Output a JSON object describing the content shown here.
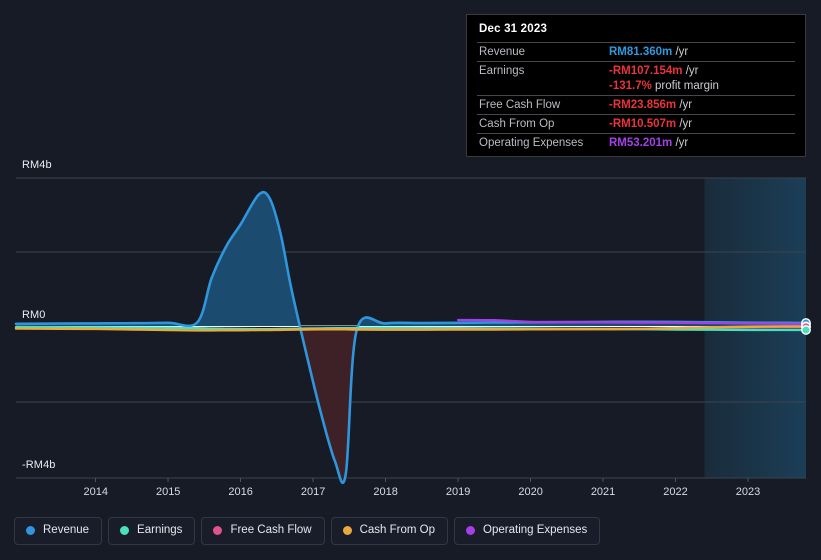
{
  "tooltip": {
    "date": "Dec 31 2023",
    "rows": [
      {
        "key": "Revenue",
        "value": "RM81.360m",
        "unit": "/yr",
        "color": "revenue"
      },
      {
        "key": "Earnings",
        "value": "-RM107.154m",
        "unit": "/yr",
        "color": "negative"
      },
      {
        "key": "",
        "value": "-131.7%",
        "unit": "profit margin",
        "color": "negative",
        "sub": true
      },
      {
        "key": "Free Cash Flow",
        "value": "-RM23.856m",
        "unit": "/yr",
        "color": "negative"
      },
      {
        "key": "Cash From Op",
        "value": "-RM10.507m",
        "unit": "/yr",
        "color": "negative"
      },
      {
        "key": "Operating Expenses",
        "value": "RM53.201m",
        "unit": "/yr",
        "color": "opex"
      }
    ]
  },
  "axis": {
    "y_top": "RM4b",
    "y_zero": "RM0",
    "y_bottom": "-RM4b"
  },
  "legend": {
    "items": [
      {
        "label": "Revenue",
        "color": "#2f96dd"
      },
      {
        "label": "Earnings",
        "color": "#4ae0c0"
      },
      {
        "label": "Free Cash Flow",
        "color": "#e0538c"
      },
      {
        "label": "Cash From Op",
        "color": "#eaa93c"
      },
      {
        "label": "Operating Expenses",
        "color": "#a640e6"
      }
    ]
  },
  "chart_data": {
    "type": "area",
    "title": "",
    "xlabel": "",
    "ylabel": "",
    "currency": "RM",
    "ylim": [
      -4000000000,
      4000000000
    ],
    "yticks": [
      4000000000,
      2000000000,
      0,
      -2000000000,
      -4000000000
    ],
    "ytick_labels": [
      "RM4b",
      "",
      "RM0",
      "",
      "-RM4b"
    ],
    "grid": true,
    "legend_position": "bottom",
    "xlim": [
      2013.4,
      2024.3
    ],
    "categories": [
      "2014",
      "2015",
      "2016",
      "2017",
      "2018",
      "2019",
      "2020",
      "2021",
      "2022",
      "2023"
    ],
    "x": [
      2013.4,
      2014,
      2014.5,
      2015,
      2015.5,
      2015.9,
      2016.1,
      2016.3,
      2016.5,
      2016.75,
      2016.9,
      2017.05,
      2017.2,
      2017.4,
      2017.6,
      2017.8,
      2017.95,
      2018.1,
      2018.5,
      2019,
      2019.5,
      2020,
      2020.5,
      2021,
      2021.5,
      2022,
      2022.5,
      2023,
      2023.5,
      2024.0,
      2024.3
    ],
    "forecast_start": 2022.9,
    "highlight_x": 2024.3,
    "series": [
      {
        "name": "Revenue",
        "color": "#2f96dd",
        "fill_positive": "#1b4b6e",
        "fill_negative": "#3d2126",
        "values": [
          60000000,
          65000000,
          70000000,
          75000000,
          85000000,
          95000000,
          1300000000,
          2150000000,
          2750000000,
          3550000000,
          3450000000,
          2500000000,
          1000000000,
          -700000000,
          -2300000000,
          -3650000000,
          -4000000000,
          -120000000,
          70000000,
          80000000,
          85000000,
          95000000,
          100000000,
          105000000,
          110000000,
          115000000,
          110000000,
          100000000,
          90000000,
          85000000,
          81360000
        ]
      },
      {
        "name": "Earnings",
        "color": "#4ae0c0",
        "values": [
          -30000000,
          -35000000,
          -40000000,
          -45000000,
          -50000000,
          -60000000,
          -70000000,
          -75000000,
          -80000000,
          -85000000,
          -85000000,
          -80000000,
          -75000000,
          -70000000,
          -65000000,
          -60000000,
          -60000000,
          -55000000,
          -50000000,
          -55000000,
          -60000000,
          -65000000,
          -70000000,
          -75000000,
          -80000000,
          -85000000,
          -95000000,
          -100000000,
          -105000000,
          -107000000,
          -107154000
        ]
      },
      {
        "name": "Free Cash Flow",
        "color": "#e0538c",
        "values": [
          null,
          null,
          null,
          null,
          null,
          null,
          null,
          null,
          null,
          null,
          null,
          null,
          null,
          null,
          null,
          null,
          null,
          -90000000,
          -95000000,
          -95000000,
          -90000000,
          -90000000,
          -85000000,
          -85000000,
          -80000000,
          -75000000,
          -60000000,
          -40000000,
          -30000000,
          -25000000,
          -23856000
        ]
      },
      {
        "name": "Cash From Op",
        "color": "#eaa93c",
        "values": [
          -70000000,
          -75000000,
          -80000000,
          -95000000,
          -110000000,
          -120000000,
          -120000000,
          -115000000,
          -115000000,
          -110000000,
          -110000000,
          -105000000,
          -100000000,
          -95000000,
          -90000000,
          -90000000,
          -90000000,
          -95000000,
          -100000000,
          -100000000,
          -95000000,
          -95000000,
          -90000000,
          -85000000,
          -85000000,
          -80000000,
          -60000000,
          -35000000,
          -20000000,
          -12000000,
          -10507000
        ]
      },
      {
        "name": "Operating Expenses",
        "color": "#a640e6",
        "values": [
          null,
          null,
          null,
          null,
          null,
          null,
          null,
          null,
          null,
          null,
          null,
          null,
          null,
          null,
          null,
          null,
          null,
          null,
          null,
          null,
          160000000,
          155000000,
          110000000,
          105000000,
          100000000,
          95000000,
          90000000,
          80000000,
          70000000,
          58000000,
          53201000
        ]
      }
    ]
  }
}
